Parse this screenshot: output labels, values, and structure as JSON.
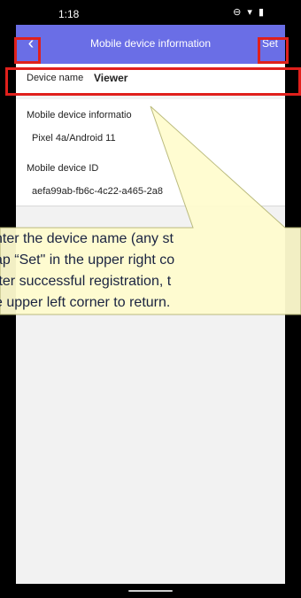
{
  "status": {
    "time": "1:18",
    "icons": "⊖ ▾ ▮"
  },
  "appbar": {
    "title": "Mobile device information",
    "set_label": "Set"
  },
  "form": {
    "device_name_label": "Device name",
    "device_name_value": "Viewer",
    "device_info_label": "Mobile device informatio",
    "device_info_value": "Pixel 4a/Android 11",
    "device_id_label": "Mobile device ID",
    "device_id_value": "aefa99ab-fb6c-4c22-a465-2a8"
  },
  "callout": {
    "lines": [
      "nter the device name (any st",
      "ap “Set\" in the upper right co",
      "fter successful registration, t",
      "e upper left corner to return."
    ]
  },
  "colors": {
    "appbar": "#6a6ee6",
    "highlight": "#e0201c",
    "callout_fill": "#fffccf",
    "callout_border": "#b8b878"
  }
}
